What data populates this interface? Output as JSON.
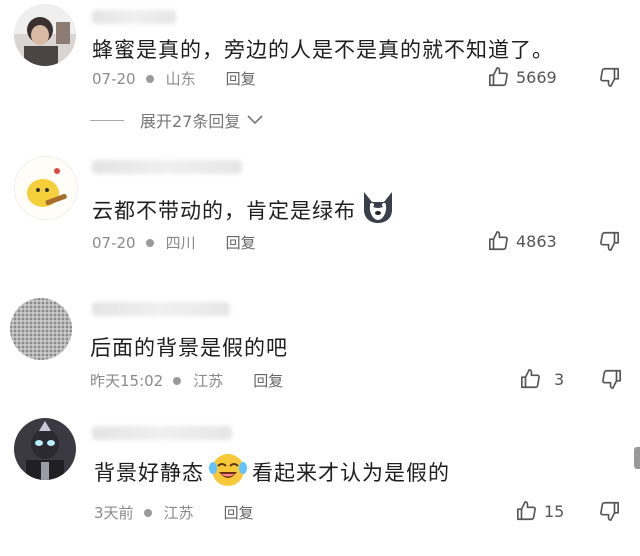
{
  "comments": [
    {
      "text": "蜂蜜是真的，旁边的人是不是真的就不知道了。",
      "date": "07-20",
      "location": "山东",
      "reply_label": "回复",
      "likes": "5669",
      "expand_label": "展开27条回复",
      "avatar": "person-photo"
    },
    {
      "text": "云都不带动的，肯定是绿布",
      "date": "07-20",
      "location": "四川",
      "reply_label": "回复",
      "likes": "4863",
      "emoji": "husky-dog-emoji",
      "avatar": "yellow-chick-guitar"
    },
    {
      "text": "后面的背景是假的吧",
      "date": "昨天15:02",
      "location": "江苏",
      "reply_label": "回复",
      "likes": "3",
      "avatar": "gray-texture"
    },
    {
      "text_before": "背景好静态",
      "text_after": "看起来才认为是假的",
      "date": "3天前",
      "location": "江苏",
      "reply_label": "回复",
      "likes": "15",
      "emoji": "laughing-crying-emoji",
      "avatar": "ultraman-figure"
    }
  ],
  "colors": {
    "text": "#1e1e1e",
    "meta": "#8a8a8a",
    "icon": "#555555"
  }
}
